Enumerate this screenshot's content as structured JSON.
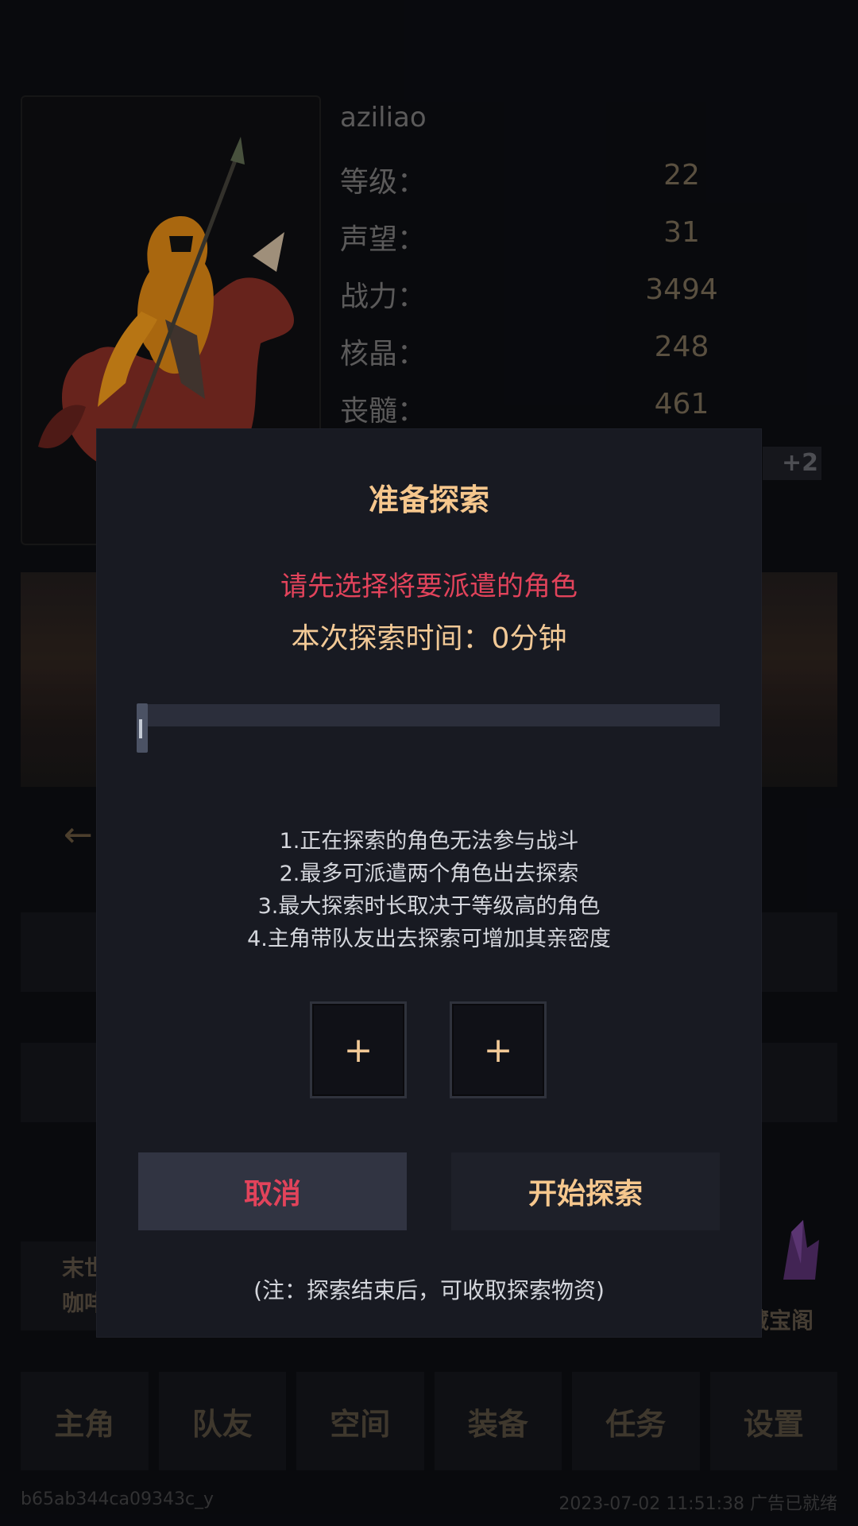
{
  "profile": {
    "name": "aziliao",
    "stats": [
      {
        "label": "等级：",
        "value": "22"
      },
      {
        "label": "声望：",
        "value": "31"
      },
      {
        "label": "战力：",
        "value": "3494"
      },
      {
        "label": "核晶：",
        "value": "248"
      },
      {
        "label": "丧髓：",
        "value": "461"
      }
    ],
    "badge": "+2"
  },
  "poi": {
    "left_line1": "末世",
    "left_line2": "咖啡",
    "right_label": "藏宝阁"
  },
  "tabs": [
    "主角",
    "队友",
    "空间",
    "装备",
    "任务",
    "设置"
  ],
  "footer": {
    "device_id": "b65ab344ca09343c_y",
    "status": "2023-07-02 11:51:38 广告已就绪"
  },
  "dialog": {
    "title": "准备探索",
    "warning": "请先选择将要派遣的角色",
    "time_text": "本次探索时间：0分钟",
    "slider_value": 0,
    "rules": [
      "1.正在探索的角色无法参与战斗",
      "2.最多可派遣两个角色出去探索",
      "3.最大探索时长取决于等级高的角色",
      "4.主角带队友出去探索可增加其亲密度"
    ],
    "slot_symbol": "+",
    "cancel_label": "取消",
    "start_label": "开始探索",
    "note": "(注：探索结束后，可收取探索物资)"
  },
  "colors": {
    "accent_gold": "#f6c78d",
    "warning_red": "#e2435b",
    "dialog_bg": "#181a22"
  }
}
